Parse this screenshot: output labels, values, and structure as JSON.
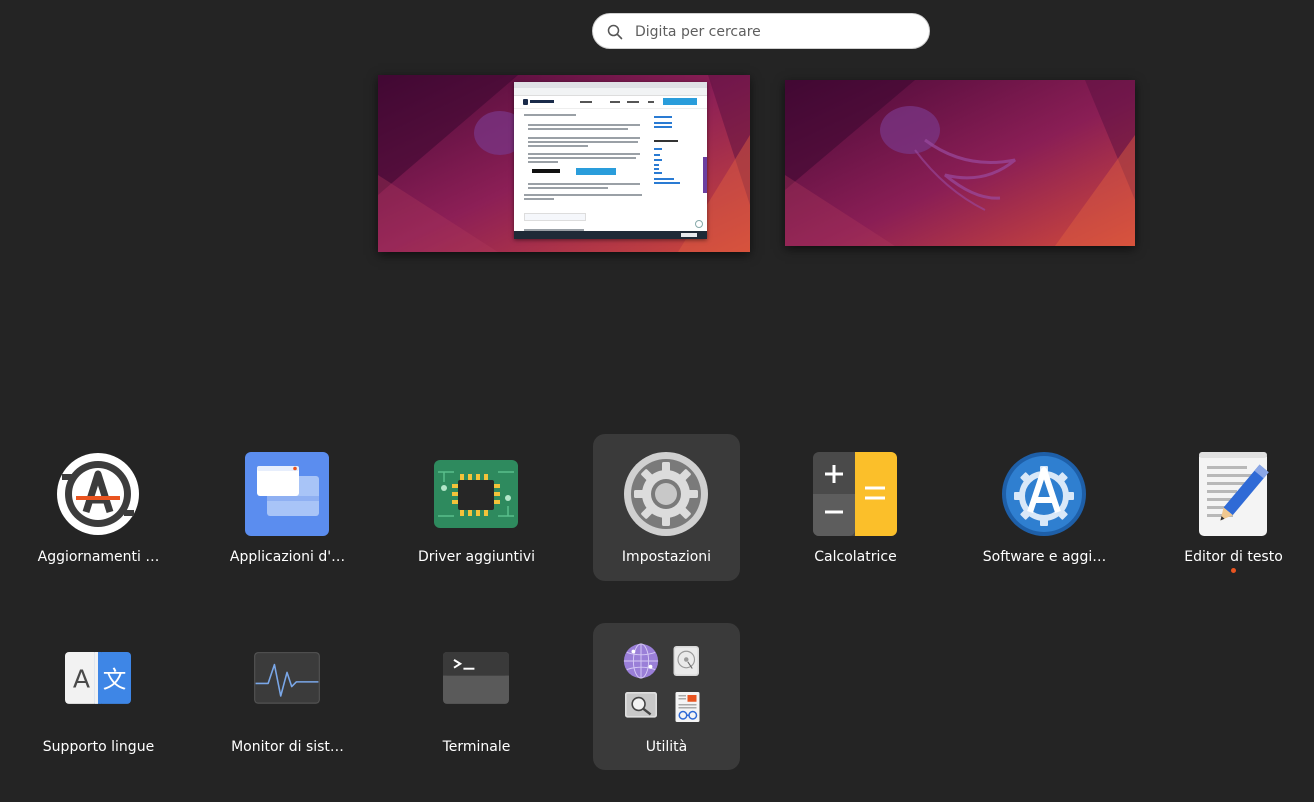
{
  "search": {
    "placeholder": "Digita per cercare"
  },
  "accent_color": "#e95420",
  "apps": [
    {
      "id": "aggiornamenti",
      "label": "Aggiornamenti …",
      "icon": "software-updater-icon"
    },
    {
      "id": "applicazioni",
      "label": "Applicazioni d'…",
      "icon": "startup-applications-icon"
    },
    {
      "id": "driver",
      "label": "Driver aggiuntivi",
      "icon": "chip-icon"
    },
    {
      "id": "impostazioni",
      "label": "Impostazioni",
      "icon": "settings-gear-icon",
      "selected": true
    },
    {
      "id": "calcolatrice",
      "label": "Calcolatrice",
      "icon": "calculator-icon"
    },
    {
      "id": "software",
      "label": "Software e aggi…",
      "icon": "software-sources-icon"
    },
    {
      "id": "editor",
      "label": "Editor di testo",
      "icon": "text-editor-icon",
      "running": true
    },
    {
      "id": "lingue",
      "label": "Supporto lingue",
      "icon": "language-support-icon"
    },
    {
      "id": "monitor",
      "label": "Monitor di sist…",
      "icon": "system-monitor-icon"
    },
    {
      "id": "terminale",
      "label": "Terminale",
      "icon": "terminal-icon"
    },
    {
      "id": "utilita",
      "label": "Utilità",
      "icon": "folder-icon",
      "folder": true
    }
  ]
}
